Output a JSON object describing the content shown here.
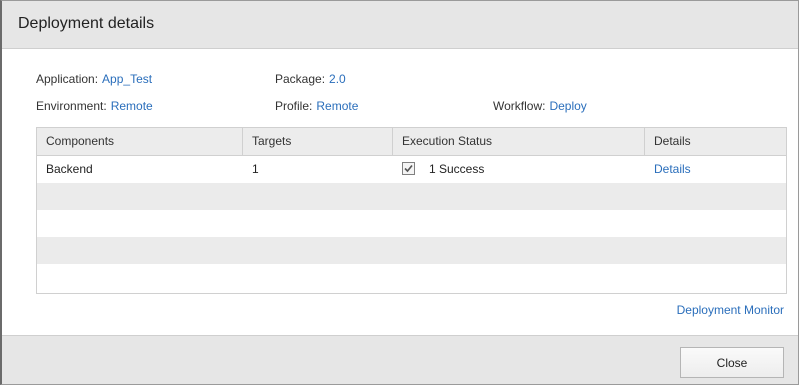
{
  "dialog": {
    "title": "Deployment details"
  },
  "summary": {
    "application_label": "Application:",
    "application_value": "App_Test",
    "package_label": "Package:",
    "package_value": "2.0",
    "environment_label": "Environment:",
    "environment_value": "Remote",
    "profile_label": "Profile:",
    "profile_value": "Remote",
    "workflow_label": "Workflow:",
    "workflow_value": "Deploy"
  },
  "table": {
    "headers": [
      "Components",
      "Targets",
      "Execution Status",
      "Details"
    ],
    "rows": [
      {
        "component": "Backend",
        "targets": "1",
        "status": "1 Success",
        "details": "Details"
      }
    ]
  },
  "links": {
    "deployment_monitor": "Deployment Monitor"
  },
  "footer": {
    "close_label": "Close"
  },
  "colors": {
    "link": "#2a6ebb",
    "titlebar": "#e6e6e6",
    "alt_row": "#ebebeb"
  }
}
